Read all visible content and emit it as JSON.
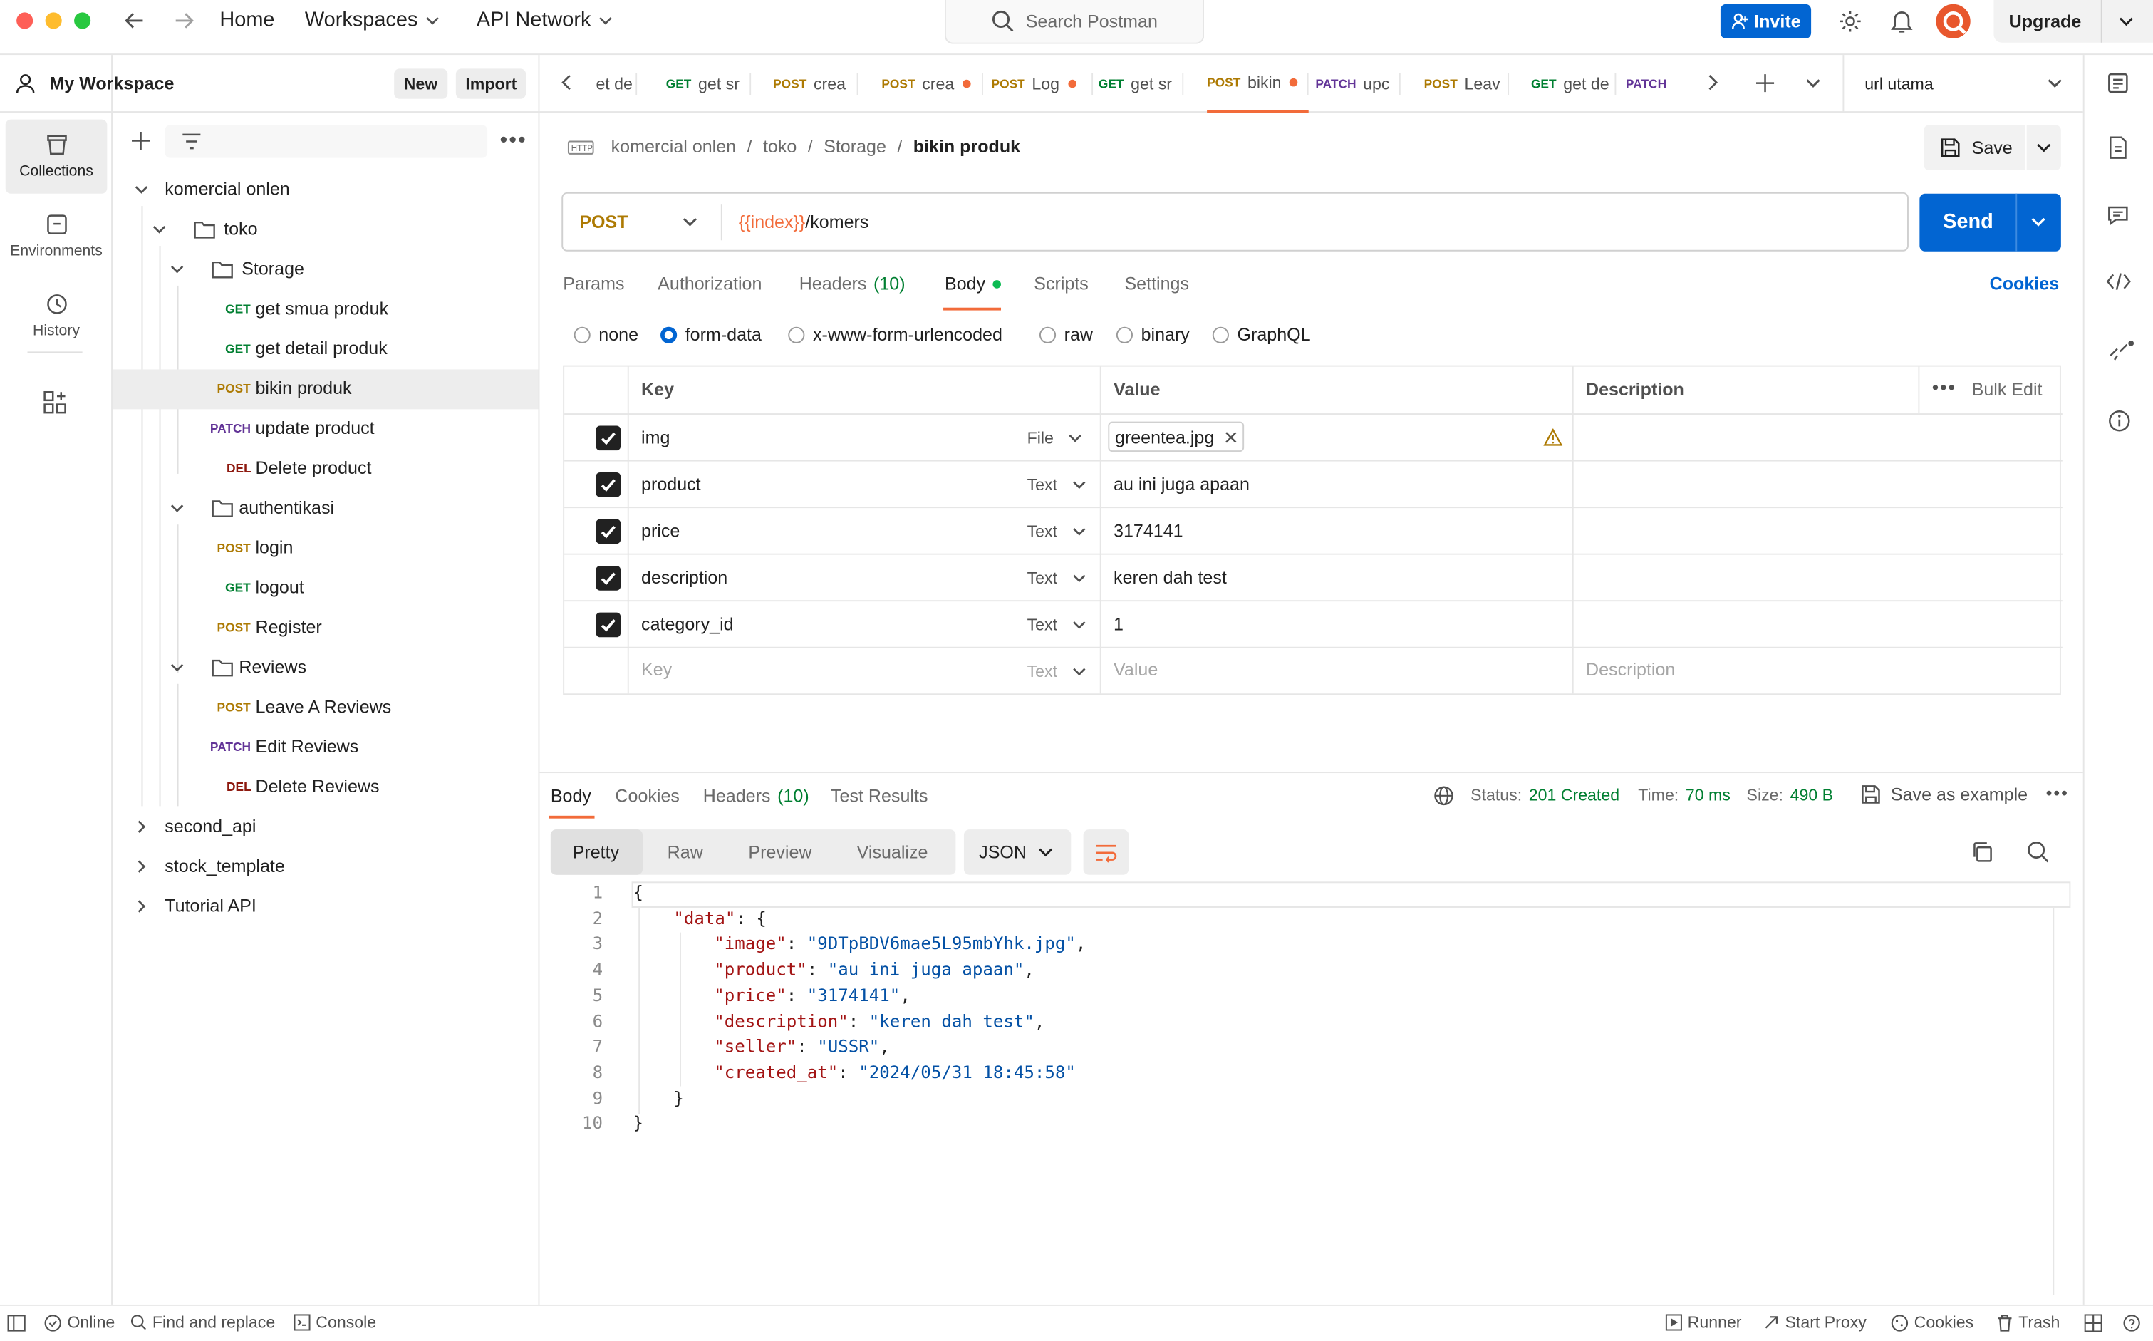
{
  "topbar": {
    "home": "Home",
    "workspaces": "Workspaces",
    "api_network": "API Network",
    "search_placeholder": "Search Postman",
    "invite": "Invite",
    "upgrade": "Upgrade"
  },
  "sidebar": {
    "workspace_name": "My Workspace",
    "new_button": "New",
    "import_button": "Import",
    "rail": [
      {
        "label": "Collections",
        "icon": "collections-icon"
      },
      {
        "label": "Environments",
        "icon": "environments-icon"
      },
      {
        "label": "History",
        "icon": "history-icon"
      }
    ],
    "tree": [
      {
        "label": "komercial onlen",
        "type": "collection"
      },
      {
        "label": "toko",
        "type": "folder"
      },
      {
        "label": "Storage",
        "type": "folder"
      },
      {
        "method": "GET",
        "label": "get smua produk"
      },
      {
        "method": "GET",
        "label": "get detail produk"
      },
      {
        "method": "POST",
        "label": "bikin produk"
      },
      {
        "method": "PATCH",
        "label": "update product"
      },
      {
        "method": "DEL",
        "label": "Delete product"
      },
      {
        "label": "authentikasi",
        "type": "folder"
      },
      {
        "method": "POST",
        "label": "login"
      },
      {
        "method": "GET",
        "label": "logout"
      },
      {
        "method": "POST",
        "label": "Register"
      },
      {
        "label": "Reviews",
        "type": "folder"
      },
      {
        "method": "POST",
        "label": "Leave A Reviews"
      },
      {
        "method": "PATCH",
        "label": "Edit Reviews"
      },
      {
        "method": "DEL",
        "label": "Delete Reviews"
      },
      {
        "label": "second_api",
        "type": "collection"
      },
      {
        "label": "stock_template",
        "type": "collection"
      },
      {
        "label": "Tutorial API",
        "type": "collection"
      }
    ]
  },
  "tabs": [
    {
      "method": "",
      "label": "et de"
    },
    {
      "method": "GET",
      "label": "get sr"
    },
    {
      "method": "POST",
      "label": "crea"
    },
    {
      "method": "POST",
      "label": "crea"
    },
    {
      "method": "POST",
      "label": "Log"
    },
    {
      "method": "GET",
      "label": "get sr"
    },
    {
      "method": "POST",
      "label": "bikin"
    },
    {
      "method": "PATCH",
      "label": "upc"
    },
    {
      "method": "POST",
      "label": "Leav"
    },
    {
      "method": "GET",
      "label": "get de"
    },
    {
      "method": "PATCH",
      "label": ""
    }
  ],
  "environment": "url utama",
  "request": {
    "breadcrumb": [
      "komercial onlen",
      "toko",
      "Storage",
      "bikin produk"
    ],
    "save": "Save",
    "method": "POST",
    "url_var": "{{index}}",
    "url_path": "/komers",
    "send": "Send",
    "tabs": {
      "params": "Params",
      "authorization": "Authorization",
      "headers": "Headers",
      "headers_count": "(10)",
      "body": "Body",
      "scripts": "Scripts",
      "settings": "Settings",
      "cookies": "Cookies"
    },
    "body_types": [
      "none",
      "form-data",
      "x-www-form-urlencoded",
      "raw",
      "binary",
      "GraphQL"
    ],
    "body_type_selected": "form-data",
    "table": {
      "headers": {
        "key": "Key",
        "value": "Value",
        "description": "Description",
        "bulk_edit": "Bulk Edit"
      },
      "rows": [
        {
          "key": "img",
          "type": "File",
          "value": "greentea.jpg"
        },
        {
          "key": "product",
          "type": "Text",
          "value": "au ini juga apaan"
        },
        {
          "key": "price",
          "type": "Text",
          "value": "3174141"
        },
        {
          "key": "description",
          "type": "Text",
          "value": "keren dah test"
        },
        {
          "key": "category_id",
          "type": "Text",
          "value": "1"
        }
      ],
      "placeholder": {
        "key": "Key",
        "type": "Text",
        "value": "Value",
        "description": "Description"
      }
    }
  },
  "response": {
    "tabs": {
      "body": "Body",
      "cookies": "Cookies",
      "headers": "Headers",
      "headers_count": "(10)",
      "test_results": "Test Results"
    },
    "status_label": "Status:",
    "status_value": "201 Created",
    "time_label": "Time:",
    "time_value": "70 ms",
    "size_label": "Size:",
    "size_value": "490 B",
    "save_example": "Save as example",
    "views": [
      "Pretty",
      "Raw",
      "Preview",
      "Visualize"
    ],
    "format": "JSON",
    "body_lines": [
      "{",
      "\"data\": {",
      "\"image\": \"9DTpBDV6mae5L95mbYhk.jpg\",",
      "\"product\": \"au ini juga apaan\",",
      "\"price\": \"3174141\",",
      "\"description\": \"keren dah test\",",
      "\"seller\": \"USSR\",",
      "\"created_at\": \"2024/05/31 18:45:58\"",
      "}",
      "}"
    ],
    "body_json": {
      "image": "9DTpBDV6mae5L95mbYhk.jpg",
      "product": "au ini juga apaan",
      "price": "3174141",
      "description": "keren dah test",
      "seller": "USSR",
      "created_at": "2024/05/31 18:45:58"
    }
  },
  "statusbar": {
    "online": "Online",
    "find_replace": "Find and replace",
    "console": "Console",
    "runner": "Runner",
    "start_proxy": "Start Proxy",
    "cookies": "Cookies",
    "trash": "Trash"
  },
  "colors": {
    "accent_orange": "#f26b3a",
    "primary_blue": "#0265d2",
    "get": "#007f31",
    "post": "#ad7a03",
    "patch": "#623497",
    "delete": "#8e1a10",
    "status_green": "#007f31"
  }
}
